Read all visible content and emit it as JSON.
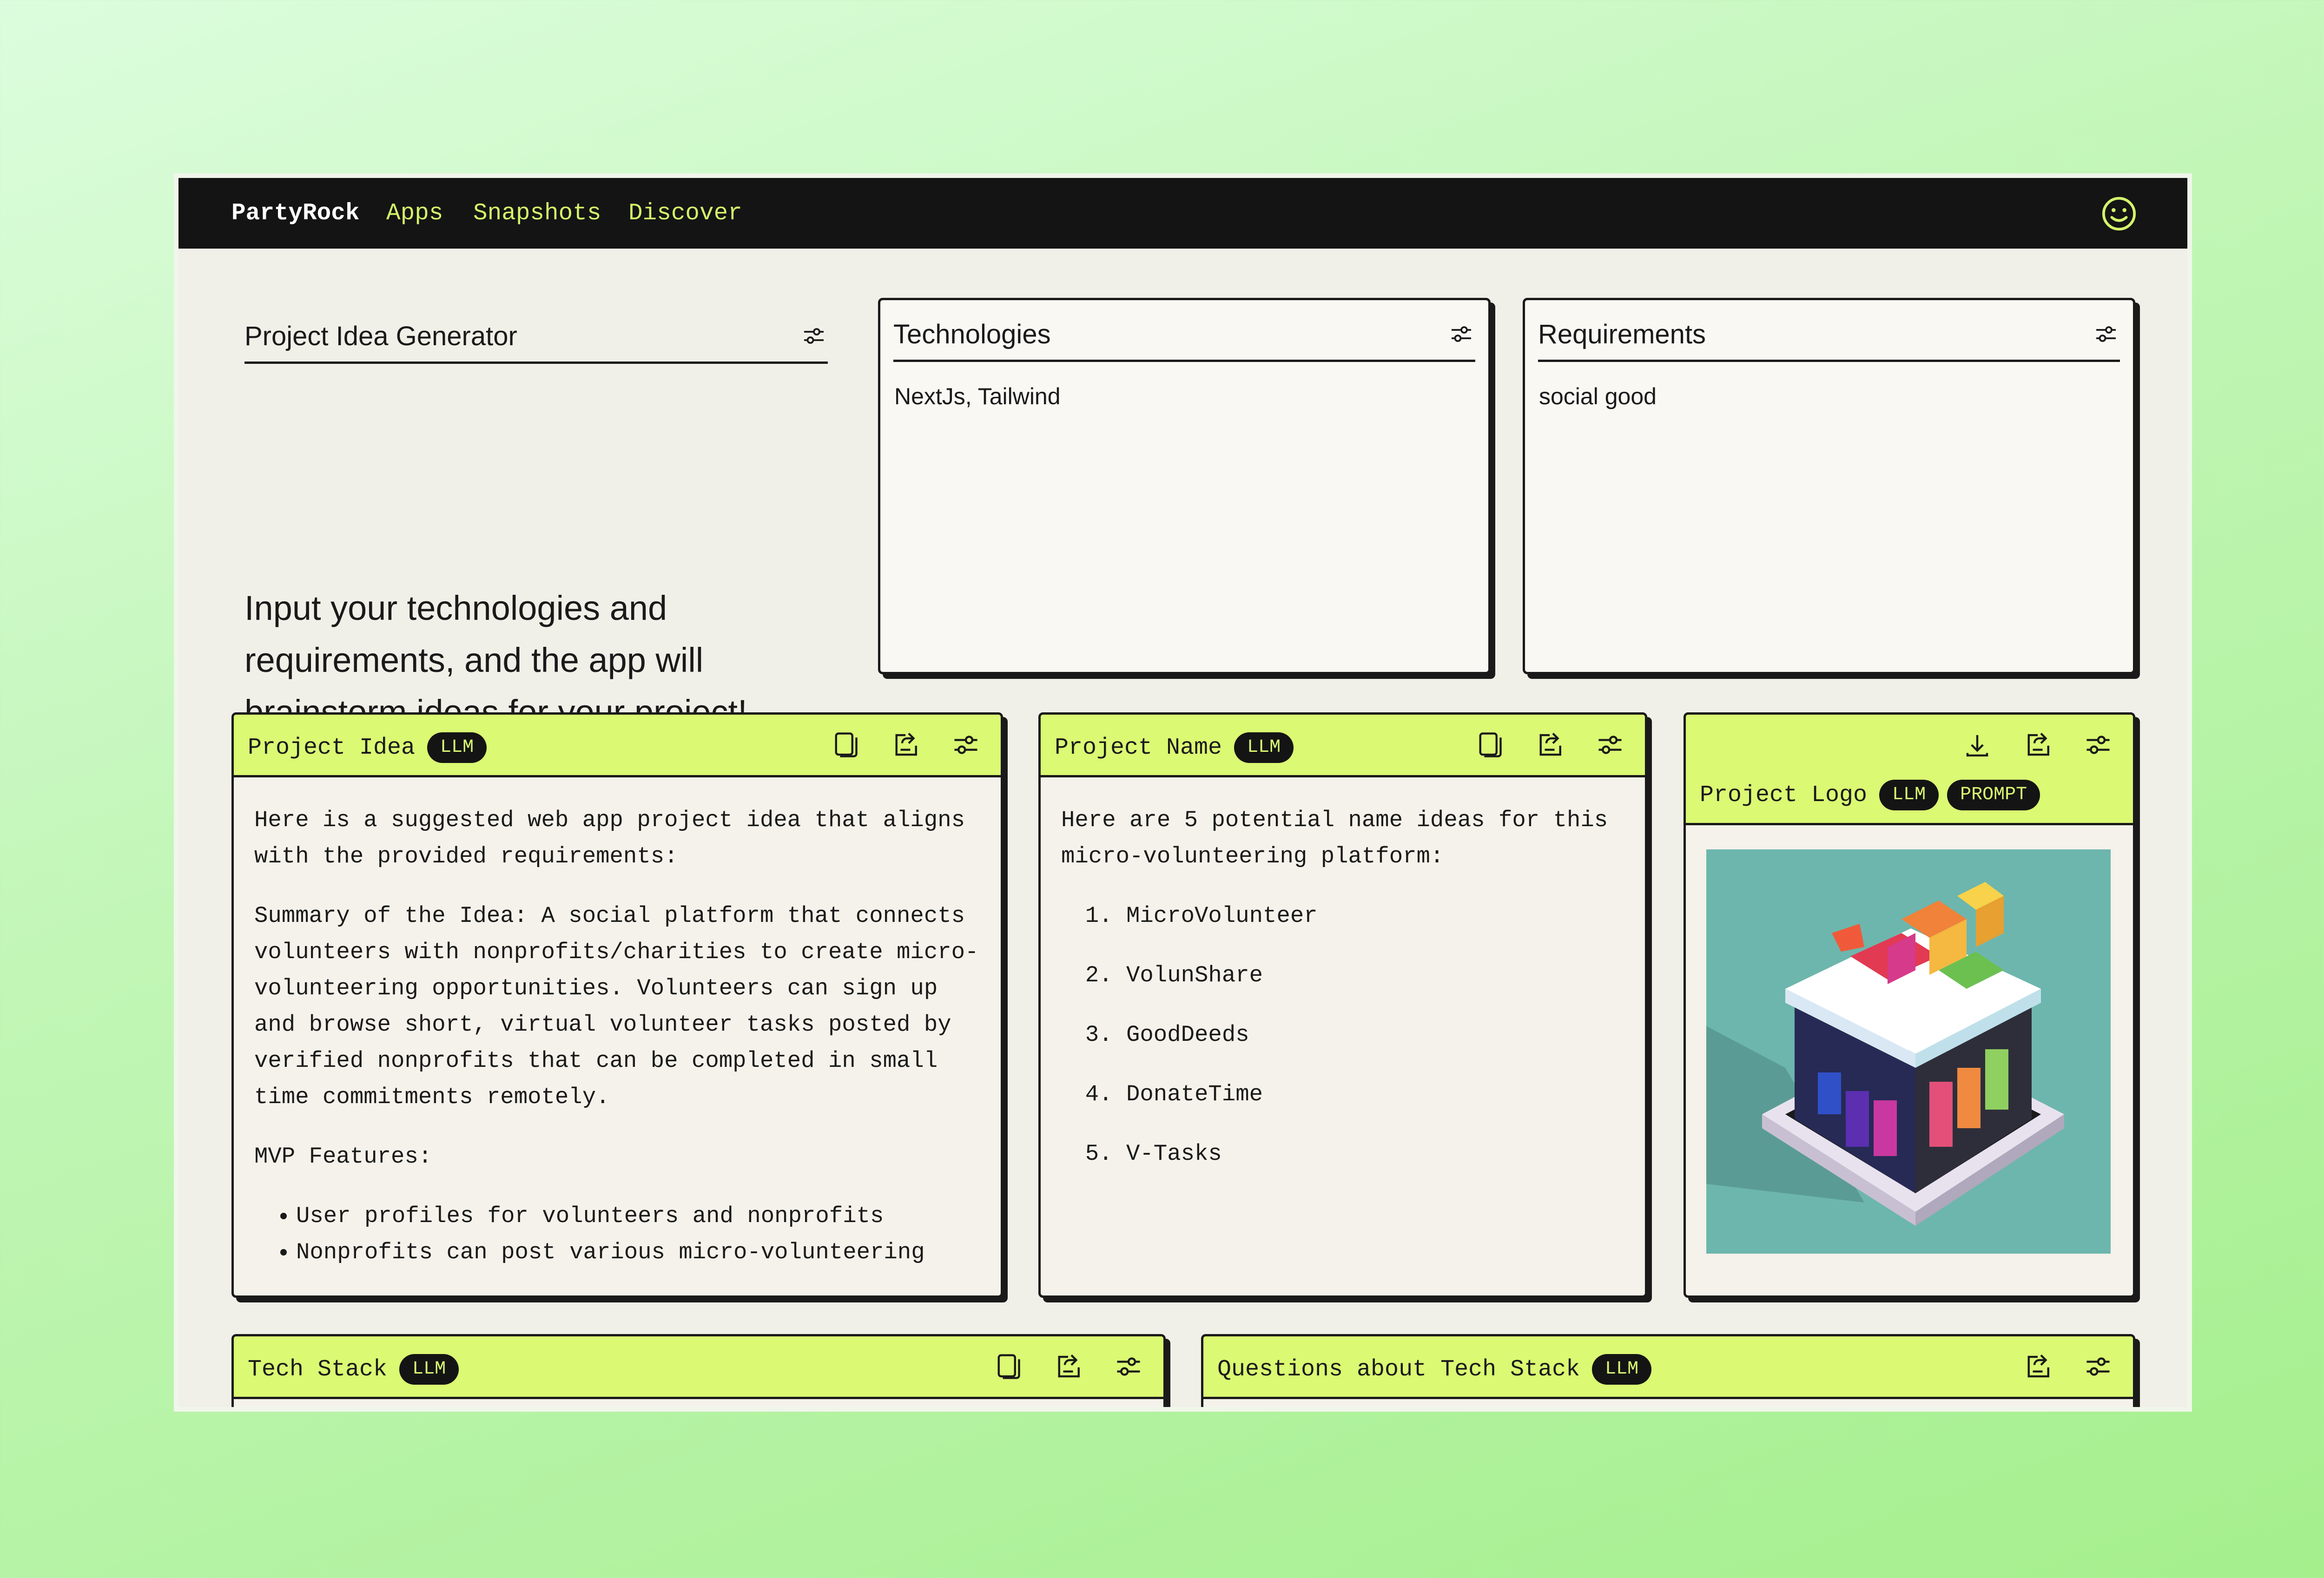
{
  "nav": {
    "brand": "PartyRock",
    "links": [
      "Apps",
      "Snapshots",
      "Discover"
    ]
  },
  "header": {
    "title": "Project Idea Generator",
    "intro": "Input your technologies and requirements, and the app will brainstorm ideas for your project!"
  },
  "inputs": {
    "technologies": {
      "title": "Technologies",
      "value": "NextJs, Tailwind"
    },
    "requirements": {
      "title": "Requirements",
      "value": "social good"
    }
  },
  "widgets": {
    "project_idea": {
      "title": "Project Idea",
      "badge": "LLM",
      "intro": "Here is a suggested web app project idea that aligns with the provided requirements:",
      "summary": "Summary of the Idea: A social platform that connects volunteers with nonprofits/charities to create micro-volunteering opportunities. Volunteers can sign up and browse short, virtual volunteer tasks posted by verified nonprofits that can be completed in small time commitments remotely.",
      "mvp_label": "MVP Features:",
      "features": [
        "User profiles for volunteers and nonprofits",
        "Nonprofits can post various micro-volunteering"
      ]
    },
    "project_name": {
      "title": "Project Name",
      "badge": "LLM",
      "intro": "Here are 5 potential name ideas for this micro-volunteering platform:",
      "names": [
        "MicroVolunteer",
        "VolunShare",
        "GoodDeeds",
        "DonateTime",
        "V-Tasks"
      ]
    },
    "project_logo": {
      "title": "Project Logo",
      "badges": [
        "LLM",
        "PROMPT"
      ]
    },
    "tech_stack": {
      "title": "Tech Stack",
      "badge": "LLM"
    },
    "questions": {
      "title": "Questions about Tech Stack",
      "badge": "LLM"
    }
  },
  "colors": {
    "accent": "#dbf973",
    "nav_bg": "#141414",
    "nav_link": "#d4f46a",
    "panel_bg": "#f1f0e8"
  }
}
